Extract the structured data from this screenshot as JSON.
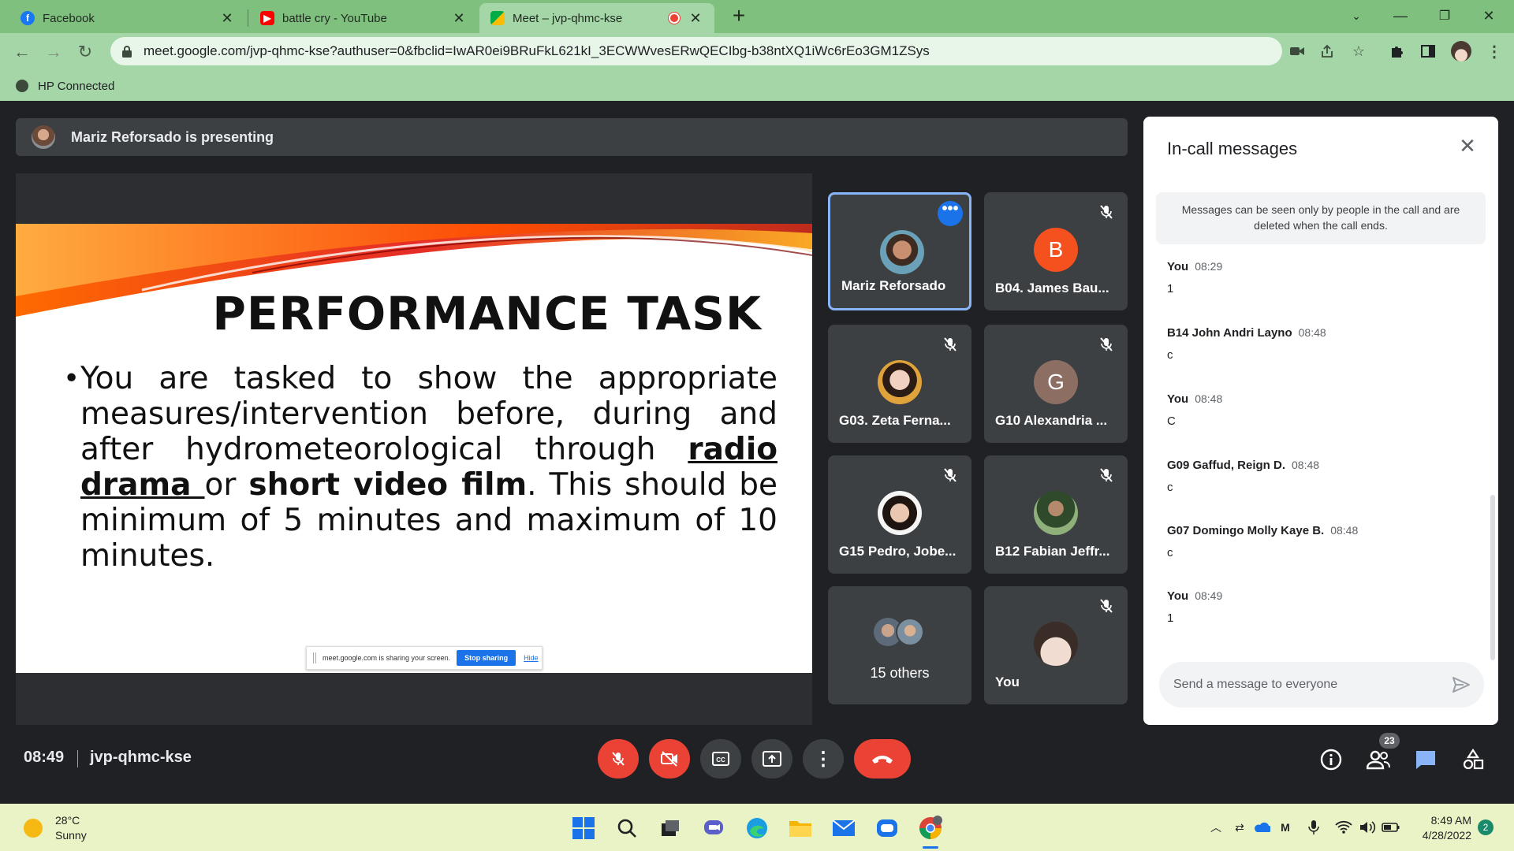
{
  "browser": {
    "tabs": [
      {
        "title": "Facebook",
        "icon": "facebook-icon"
      },
      {
        "title": "battle cry - YouTube",
        "icon": "youtube-icon"
      },
      {
        "title": "Meet – jvp-qhmc-kse",
        "icon": "meet-icon",
        "active": true
      }
    ],
    "url": "meet.google.com/jvp-qhmc-kse?authuser=0&fbclid=IwAR0ei9BRuFkL621kI_3ECWWvesERwQECIbg-b38ntXQ1iWc6rEo3GM1ZSys",
    "bookmark": "HP Connected"
  },
  "meeting": {
    "presenting": "Mariz Reforsado is presenting",
    "clock": "08:49",
    "code": "jvp-qhmc-kse",
    "participant_count": "23"
  },
  "slide": {
    "title": "PERFORMANCE TASK",
    "body_1": "You are tasked to show the appropriate measures/intervention before, during and after hydrometeorological through ",
    "body_bold_1": "radio drama ",
    "body_2": " or ",
    "body_bold_2": "short video film",
    "body_3": ". This should be minimum of 5 minutes and maximum of 10 minutes.",
    "sharebar_text": "meet.google.com is sharing your screen.",
    "stop_sharing": "Stop sharing",
    "hide": "Hide"
  },
  "participants": [
    {
      "name": "Mariz Reforsado",
      "initial": "",
      "muted": false,
      "active": true
    },
    {
      "name": "B04. James Bau...",
      "initial": "B",
      "muted": true,
      "color": "#f4511e"
    },
    {
      "name": "G03. Zeta Ferna...",
      "initial": "",
      "muted": true
    },
    {
      "name": "G10 Alexandria ...",
      "initial": "G",
      "muted": true,
      "color": "#8d6e63"
    },
    {
      "name": "G15 Pedro, Jobe...",
      "initial": "",
      "muted": true
    },
    {
      "name": "B12 Fabian Jeffr...",
      "initial": "",
      "muted": true
    },
    {
      "name": "15 others",
      "initial": "",
      "muted": false
    },
    {
      "name": "You",
      "initial": "",
      "muted": true
    }
  ],
  "chat": {
    "title": "In-call messages",
    "note": "Messages can be seen only by people in the call and are deleted when the call ends.",
    "messages": [
      {
        "sender": "You",
        "time": "08:29",
        "text": "1"
      },
      {
        "sender": "B14 John Andri Layno",
        "time": "08:48",
        "text": "c"
      },
      {
        "sender": "You",
        "time": "08:48",
        "text": "C"
      },
      {
        "sender": "G09 Gaffud, Reign D.",
        "time": "08:48",
        "text": "c"
      },
      {
        "sender": "G07 Domingo Molly Kaye B.",
        "time": "08:48",
        "text": "c"
      },
      {
        "sender": "You",
        "time": "08:49",
        "text": "1"
      }
    ],
    "placeholder": "Send a message to everyone"
  },
  "taskbar": {
    "temp": "28°C",
    "condition": "Sunny",
    "time": "8:49 AM",
    "date": "4/28/2022",
    "notifications": "2"
  }
}
